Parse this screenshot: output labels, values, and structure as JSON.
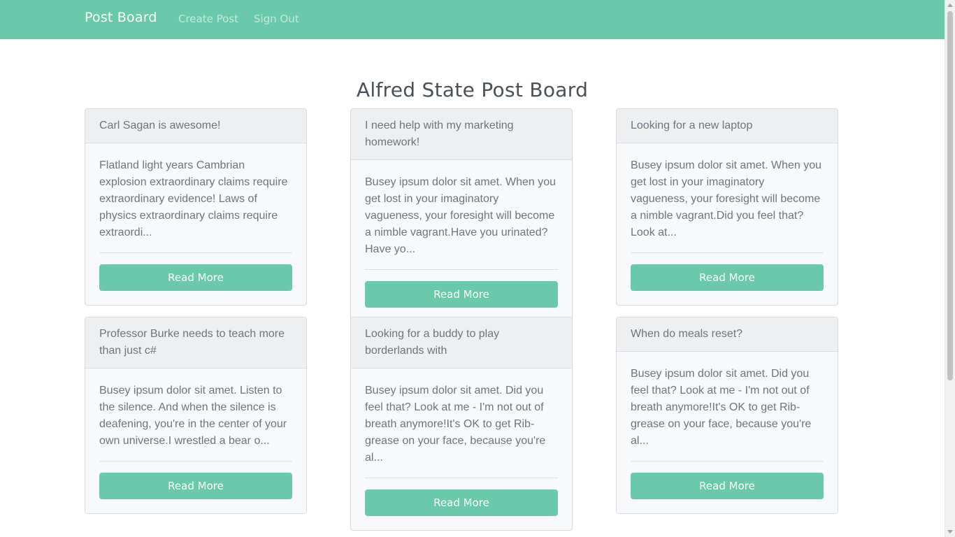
{
  "navbar": {
    "brand": "Post Board",
    "links": [
      {
        "label": "Create Post"
      },
      {
        "label": "Sign Out"
      }
    ]
  },
  "page": {
    "title": "Alfred State Post Board"
  },
  "posts": [
    {
      "title": "Carl Sagan is awesome!",
      "excerpt": "Flatland light years Cambrian explosion extraordinary claims require extraordinary evidence! Laws of physics extraordinary claims require extraordi...",
      "button": "Read More"
    },
    {
      "title": "I need help with my marketing homework!",
      "excerpt": "Busey ipsum dolor sit amet. When you get lost in your imaginatory vagueness, your foresight will become a nimble vagrant.Have you urinated? Have yo...",
      "button": "Read More"
    },
    {
      "title": "Looking for a new laptop",
      "excerpt": "Busey ipsum dolor sit amet. When you get lost in your imaginatory vagueness, your foresight will become a nimble vagrant.Did you feel that? Look at...",
      "button": "Read More"
    },
    {
      "title": "Professor Burke needs to teach more than just c#",
      "excerpt": "Busey ipsum dolor sit amet. Listen to the silence. And when the silence is deafening, you're in the center of your own universe.I wrestled a bear o...",
      "button": "Read More"
    },
    {
      "title": "Looking for a buddy to play borderlands with",
      "excerpt": "Busey ipsum dolor sit amet. Did you feel that? Look at me - I'm not out of breath anymore!It's OK to get Rib-grease on your face, because you're al...",
      "button": "Read More"
    },
    {
      "title": "When do meals reset?",
      "excerpt": "Busey ipsum dolor sit amet. Did you feel that? Look at me - I'm not out of breath anymore!It's OK to get Rib-grease on your face, because you're al...",
      "button": "Read More"
    }
  ],
  "colors": {
    "accent": "#6ac9ab",
    "card_bg": "#f8f9fa",
    "card_header_bg": "#eeeff0",
    "text": "#6c757d"
  }
}
